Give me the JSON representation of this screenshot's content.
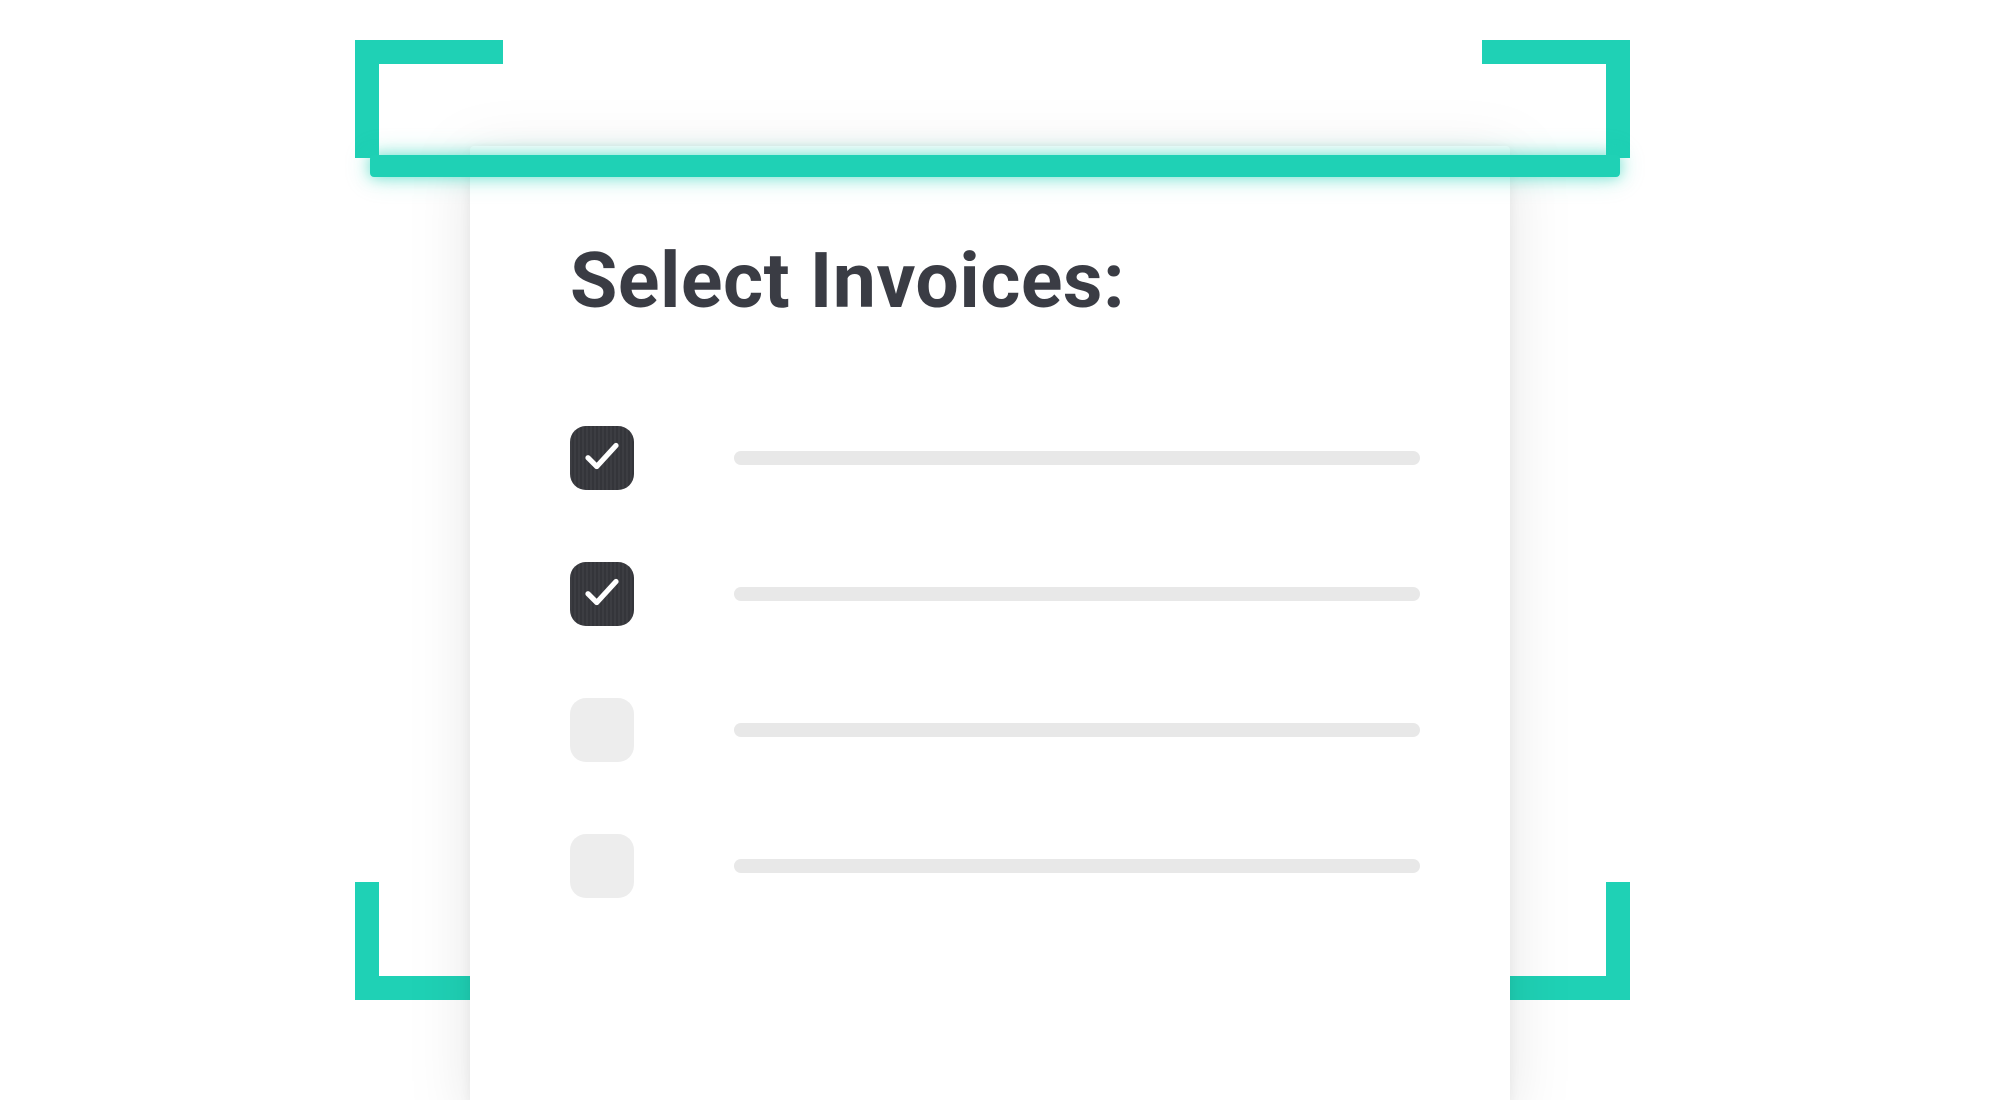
{
  "colors": {
    "accent": "#1fd1b5",
    "heading": "#3a3c44",
    "checkbox_checked_bg": "#34353a",
    "checkbox_unchecked_bg": "#ededed",
    "placeholder_bar": "#e8e8e8"
  },
  "card": {
    "title": "Select Invoices:",
    "items": [
      {
        "checked": true
      },
      {
        "checked": true
      },
      {
        "checked": false
      },
      {
        "checked": false
      }
    ]
  }
}
